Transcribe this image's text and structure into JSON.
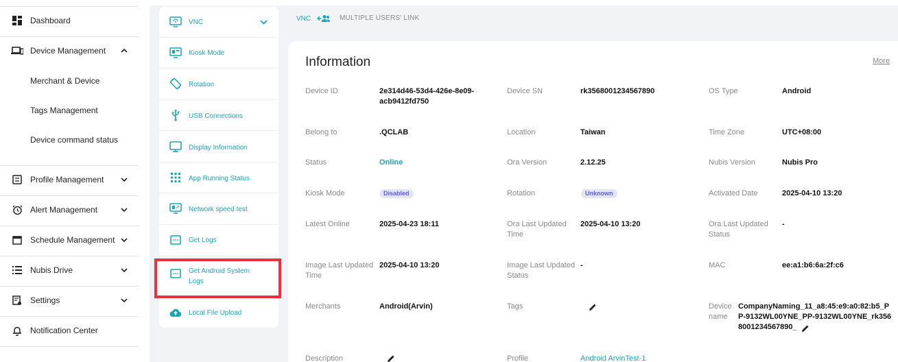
{
  "sidebar": {
    "dashboard": "Dashboard",
    "device_management": "Device Management",
    "merchant_device": "Merchant & Device",
    "tags_management": "Tags Management",
    "device_command_status": "Device command status",
    "profile_management": "Profile Management",
    "alert_management": "Alert Management",
    "schedule_management": "Schedule Management",
    "nubis_drive": "Nubis Drive",
    "settings": "Settings",
    "notification_center": "Notification Center"
  },
  "features": {
    "vnc": "VNC",
    "kiosk_mode": "Kiosk Mode",
    "rotation": "Rotation",
    "usb_connections": "USB Connections",
    "display_information": "Display Information",
    "app_running_status": "App Running Status",
    "network_speed_test": "Network speed test",
    "get_logs": "Get Logs",
    "get_android_system_logs": "Get Android System Logs",
    "local_file_upload": "Local File Upload"
  },
  "tabs": {
    "vnc": "VNC",
    "multiple_users_link": "MULTIPLE USERS' LINK"
  },
  "info": {
    "title": "Information",
    "more": "More",
    "device_id_label": "Device ID",
    "device_id": "2e314d46-53d4-426e-8e09-acb9412fd750",
    "device_sn_label": "Device SN",
    "device_sn": "rk3568001234567890",
    "os_type_label": "OS Type",
    "os_type": "Android",
    "belong_to_label": "Belong to",
    "belong_to": ".QCLAB",
    "location_label": "Location",
    "location": "Taiwan",
    "time_zone_label": "Time Zone",
    "time_zone": "UTC+08:00",
    "status_label": "Status",
    "status": "Online",
    "ora_version_label": "Ora Version",
    "ora_version": "2.12.25",
    "nubis_version_label": "Nubis Version",
    "nubis_version": "Nubis Pro",
    "kiosk_mode_label": "Kiosk Mode",
    "kiosk_mode": "Disabled",
    "rotation_label": "Rotation",
    "rotation": "Unknown",
    "activated_date_label": "Activated Date",
    "activated_date": "2025-04-10 13:20",
    "latest_online_label": "Latest Online",
    "latest_online": "2025-04-23 18:11",
    "ora_last_updated_time_label": "Ora Last Updated Time",
    "ora_last_updated_time": "2025-04-10 13:20",
    "ora_last_updated_status_label": "Ora Last Updated Status",
    "ora_last_updated_status": "-",
    "image_last_updated_time_label": "Image Last Updated Time",
    "image_last_updated_time": "2025-04-10 13:20",
    "image_last_updated_status_label": "Image Last Updated Status",
    "image_last_updated_status": "-",
    "mac_label": "MAC",
    "mac": "ee:a1:b6:6a:2f:c6",
    "merchants_label": "Merchants",
    "merchants": "Android(Arvin)",
    "tags_label": "Tags",
    "device_name_label": "Device name",
    "device_name": "CompanyNaming_11_a8:45:e9:a0:82:b5_PP-9132WL00YNE_PP-9132WL00YNE_rk3568001234567890_",
    "description_label": "Description",
    "profile_label": "Profile",
    "profile": "Android ArvinTest-1"
  },
  "colors": {
    "accent": "#1aa6b7",
    "highlight": "#e8323c",
    "badge_text": "#5b5fd6",
    "badge_bg": "#e4e4f7"
  },
  "icons": {
    "dashboard": "dashboard-icon",
    "device_management": "laptop-icon",
    "profile_management": "profile-icon",
    "alert_management": "alarm-clock-icon",
    "schedule_management": "calendar-icon",
    "nubis_drive": "list-icon",
    "settings": "settings-doc-icon",
    "notification_center": "bell-icon"
  }
}
